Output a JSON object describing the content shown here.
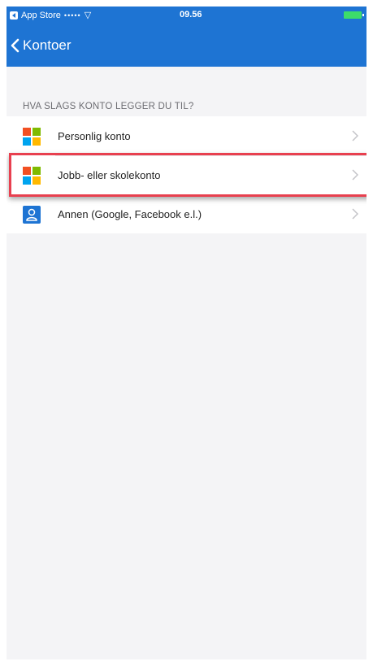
{
  "status_bar": {
    "back_app": "App Store",
    "signal": "•••••",
    "time": "09.56"
  },
  "nav": {
    "back_label": "Kontoer"
  },
  "section": {
    "header": "HVA SLAGS KONTO LEGGER DU TIL?"
  },
  "accounts": [
    {
      "label": "Personlig konto",
      "icon": "microsoft-logo-icon"
    },
    {
      "label": "Jobb- eller skolekonto",
      "icon": "microsoft-logo-icon",
      "highlighted": true
    },
    {
      "label": "Annen (Google, Facebook e.l.)",
      "icon": "person-icon"
    }
  ],
  "colors": {
    "accent": "#1e74d3",
    "highlight": "#e8404f",
    "ms_red": "#f25022",
    "ms_green": "#7fba00",
    "ms_blue": "#00a4ef",
    "ms_yellow": "#ffb900"
  }
}
